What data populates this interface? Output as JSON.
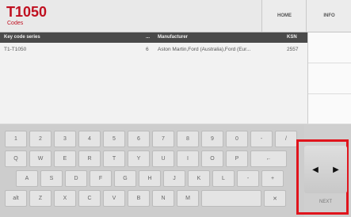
{
  "header": {
    "title": "T1050",
    "subtitle": "Codes",
    "nav": [
      "HOME",
      "INFO"
    ]
  },
  "table": {
    "columns": [
      "Key code series",
      "...",
      "Manufacturer",
      "KSN"
    ],
    "rows": [
      [
        "T1-T1050",
        "6",
        "Aston Martin,Ford (Australia),Ford (Eur...",
        "2557"
      ]
    ]
  },
  "keyboard": {
    "row1": [
      "1",
      "2",
      "3",
      "4",
      "5",
      "6",
      "7",
      "8",
      "9",
      "0",
      "-",
      "/"
    ],
    "row2": [
      "Q",
      "W",
      "E",
      "R",
      "T",
      "Y",
      "U",
      "I",
      "O",
      "P",
      "←"
    ],
    "row3": [
      "A",
      "S",
      "D",
      "F",
      "G",
      "H",
      "J",
      "K",
      "L",
      "-",
      "+"
    ],
    "row4": [
      "alt",
      "Z",
      "X",
      "C",
      "V",
      "B",
      "N",
      "M",
      "",
      "✕"
    ]
  },
  "right_panel": {
    "arrow_left": "◀",
    "arrow_right": "▶",
    "next_label": "NEXT"
  },
  "colors": {
    "accent": "#c01020",
    "highlight": "#e0141c",
    "table_header": "#4a4a4a"
  }
}
